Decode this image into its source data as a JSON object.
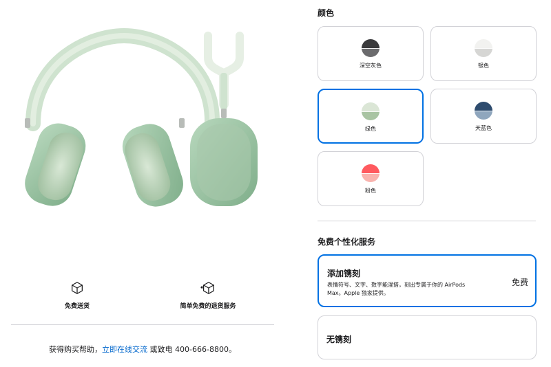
{
  "delivery": {
    "free_label": "免费送货",
    "returns_label": "简单免费的退货服务"
  },
  "help": {
    "prefix": "获得购买帮助，",
    "link": "立即在线交流",
    "suffix": " 或致电 400-666-8800。"
  },
  "colors": {
    "title": "颜色",
    "selected": "绿色",
    "options": [
      {
        "label": "深空灰色",
        "top_hex": "#3a3a3c",
        "bottom_hex": "#6b6b6d"
      },
      {
        "label": "银色",
        "top_hex": "#f2f2f0",
        "bottom_hex": "#d6d6d4"
      },
      {
        "label": "绿色",
        "top_hex": "#dbe6d6",
        "bottom_hex": "#a9c4a3"
      },
      {
        "label": "天蓝色",
        "top_hex": "#2e4c6e",
        "bottom_hex": "#8fa6bd"
      },
      {
        "label": "粉色",
        "top_hex": "#ff5a5f",
        "bottom_hex": "#f9b3ae"
      }
    ]
  },
  "engraving": {
    "title": "免费个性化服务",
    "add": {
      "name": "添加镌刻",
      "desc": "表情符号、文字、数字能混搭，刻出专属于你的 AirPods Max。Apple 独家提供。",
      "price": "免费"
    },
    "none": {
      "name": "无镌刻"
    }
  },
  "accent_color": "#0071e3",
  "link_color": "#0066cc"
}
